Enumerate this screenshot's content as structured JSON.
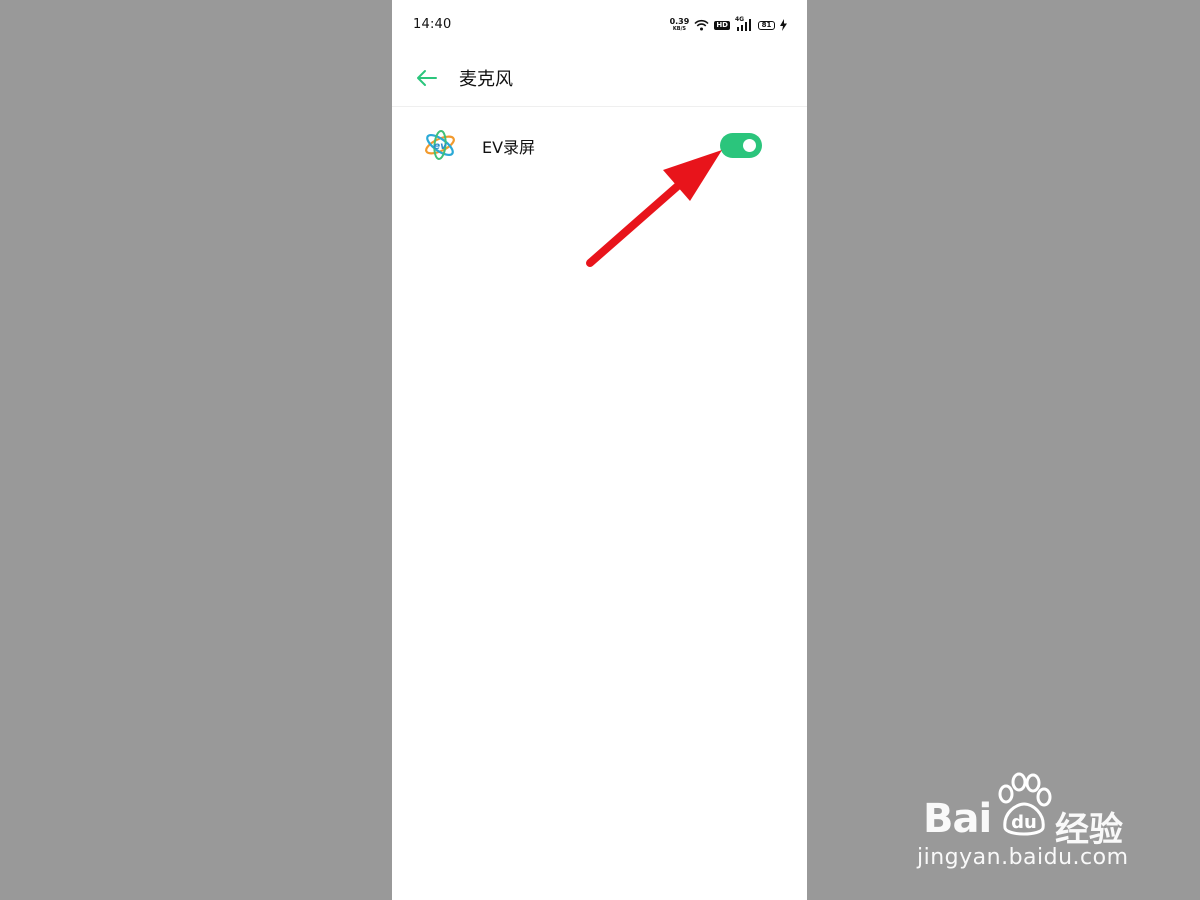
{
  "status_bar": {
    "time": "14:40",
    "net_speed_value": "0.39",
    "net_speed_unit": "KB/S",
    "hd_label": "HD",
    "network_type": "4G",
    "battery_level": "81",
    "icons": [
      "wifi-icon",
      "hd-icon",
      "signal-icon",
      "battery-icon",
      "charging-icon"
    ]
  },
  "header": {
    "title": "麦克风",
    "back_icon": "back-arrow-icon"
  },
  "permission_list": [
    {
      "app_name": "EV录屏",
      "icon": "ev-recorder-app-icon",
      "enabled": true
    }
  ],
  "colors": {
    "accent": "#2bc57c",
    "annotation_arrow": "#e8141b",
    "backdrop": "#999999"
  },
  "watermark": {
    "brand": "Bai du 经验",
    "url": "jingyan.baidu.com"
  }
}
